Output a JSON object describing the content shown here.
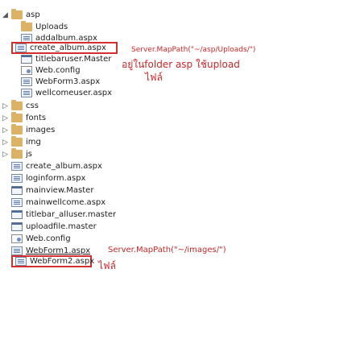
{
  "top_clip": "...",
  "tree": {
    "root": "asp",
    "uploads": "Uploads",
    "addalbum": "addalbum.aspx",
    "create_album_1": "create_album.aspx",
    "titlebar_user_1": "titlebaruser.Master",
    "webconfig_1": "Web.config",
    "webform3": "WebForm3.aspx",
    "wellcome": "wellcomeuser.aspx",
    "css": "css",
    "fonts": "fonts",
    "images": "images",
    "img": "img",
    "js": "js",
    "create_album_2": "create_album.aspx",
    "loginform": "loginform.aspx",
    "mainview": "mainview.Master",
    "mainwellcome": "mainwellcome.aspx",
    "titlebar_alluser": "titlebar_alluser.master",
    "uploadfile": "uploadfile.master",
    "webconfig_2": "Web.config",
    "webform1": "WebForm1.aspx",
    "webform2": "WebForm2.aspx"
  },
  "annotations": {
    "mappath_uploads": "Server.MapPath(\"~/asp/Uploads/\")",
    "note_line2": "อยู่ในfolder asp ใช้upload",
    "note_line3": "ไฟล์",
    "mappath_images": "Server.MapPath(\"~/images/\")",
    "note_images": "ไฟล์"
  },
  "colors": {
    "annotation": "#c62828",
    "highlight_border": "#d32f2f",
    "folder": "#dcb267"
  }
}
